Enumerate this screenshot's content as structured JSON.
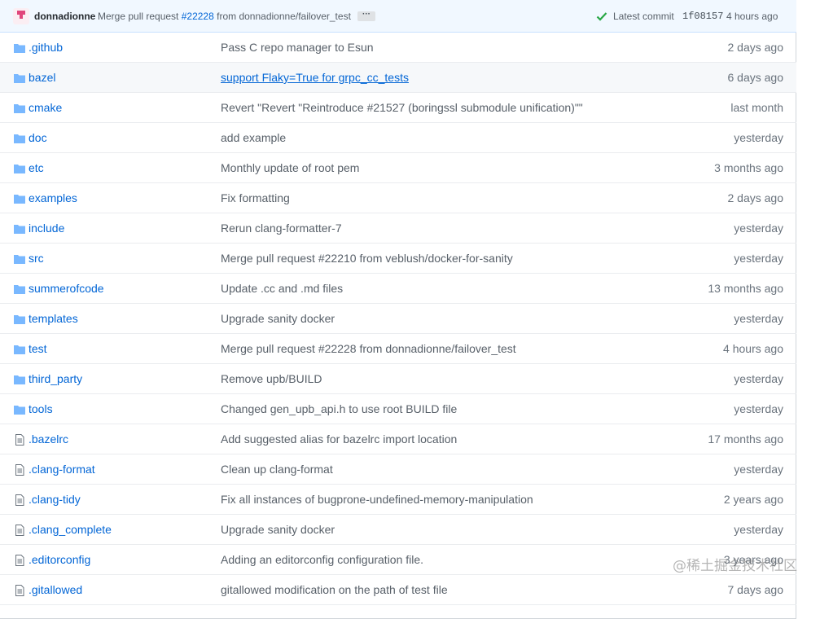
{
  "commit": {
    "author": "donnadionne",
    "message_prefix": "Merge pull request",
    "pr_number": "#22228",
    "message_suffix": "from donnadionne/failover_test",
    "ellipsis": "···",
    "latest_label": "Latest commit",
    "sha": "1f08157",
    "age": "4 hours ago",
    "status_color": "#28a745"
  },
  "files": [
    {
      "type": "folder",
      "name": ".github",
      "message": "Pass C repo manager to Esun",
      "age": "2 days ago"
    },
    {
      "type": "folder",
      "name": "bazel",
      "message": "support Flaky=True for grpc_cc_tests",
      "age": "6 days ago",
      "hover": true
    },
    {
      "type": "folder",
      "name": "cmake",
      "message": "Revert \"Revert \"Reintroduce #21527 (boringssl submodule unification)\"\"",
      "age": "last month"
    },
    {
      "type": "folder",
      "name": "doc",
      "message": "add example",
      "age": "yesterday"
    },
    {
      "type": "folder",
      "name": "etc",
      "message": "Monthly update of root pem",
      "age": "3 months ago"
    },
    {
      "type": "folder",
      "name": "examples",
      "message": "Fix formatting",
      "age": "2 days ago"
    },
    {
      "type": "folder",
      "name": "include",
      "message": "Rerun clang-formatter-7",
      "age": "yesterday"
    },
    {
      "type": "folder",
      "name": "src",
      "message": "Merge pull request #22210 from veblush/docker-for-sanity",
      "age": "yesterday"
    },
    {
      "type": "folder",
      "name": "summerofcode",
      "message": "Update .cc and .md files",
      "age": "13 months ago"
    },
    {
      "type": "folder",
      "name": "templates",
      "message": "Upgrade sanity docker",
      "age": "yesterday"
    },
    {
      "type": "folder",
      "name": "test",
      "message": "Merge pull request #22228 from donnadionne/failover_test",
      "age": "4 hours ago"
    },
    {
      "type": "folder",
      "name": "third_party",
      "message": "Remove upb/BUILD",
      "age": "yesterday"
    },
    {
      "type": "folder",
      "name": "tools",
      "message": "Changed gen_upb_api.h to use root BUILD file",
      "age": "yesterday"
    },
    {
      "type": "file",
      "name": ".bazelrc",
      "message": "Add suggested alias for bazelrc import location",
      "age": "17 months ago"
    },
    {
      "type": "file",
      "name": ".clang-format",
      "message": "Clean up clang-format",
      "age": "yesterday"
    },
    {
      "type": "file",
      "name": ".clang-tidy",
      "message": "Fix all instances of bugprone-undefined-memory-manipulation",
      "age": "2 years ago"
    },
    {
      "type": "file",
      "name": ".clang_complete",
      "message": "Upgrade sanity docker",
      "age": "yesterday"
    },
    {
      "type": "file",
      "name": ".editorconfig",
      "message": "Adding an editorconfig configuration file.",
      "age": "3 years ago"
    },
    {
      "type": "file",
      "name": ".gitallowed",
      "message": "gitallowed modification on the path of test file",
      "age": "7 days ago"
    }
  ],
  "watermark": "@稀土掘金技术社区",
  "colors": {
    "link": "#0366d6",
    "folder": "#79b8ff",
    "file": "#6a737d"
  }
}
